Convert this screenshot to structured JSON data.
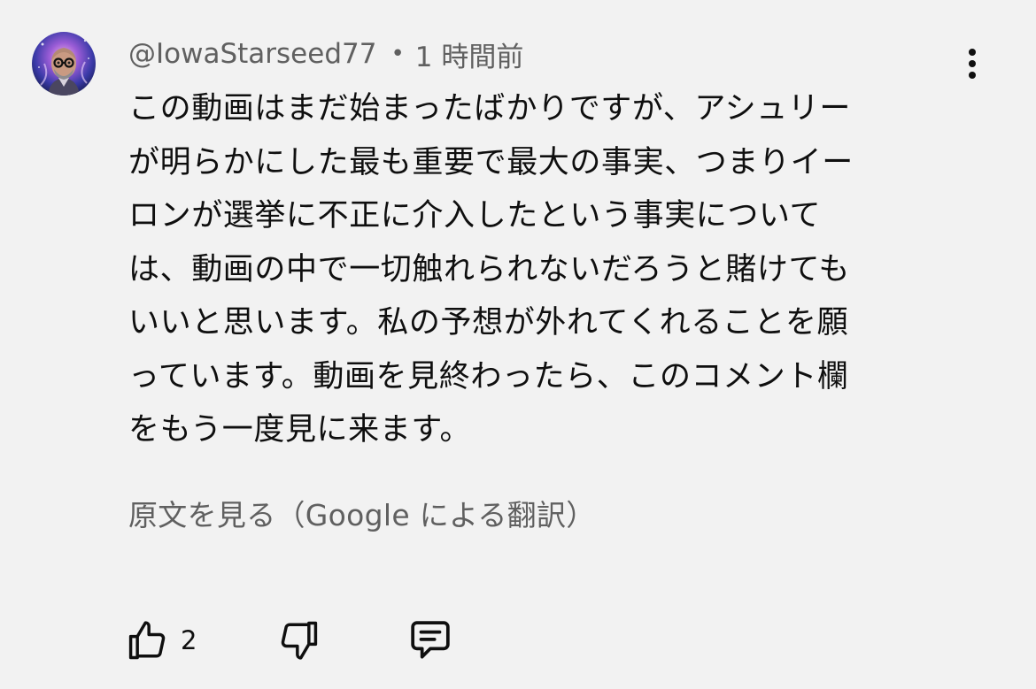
{
  "comment": {
    "author": "@IowaStarseed77",
    "separator": "•",
    "timestamp": "1 時間前",
    "text_lines": [
      "この動画はまだ始まったばかりですが、アシュリー",
      "が明らかにした最も重要で最大の事実、つまりイー",
      "ロンが選挙に不正に介入したという事実について",
      "は、動画の中で一切触れられないだろうと賭けても",
      "いいと思います。私の予想が外れてくれることを願",
      "っています。動画を見終わったら、このコメント欄",
      "をもう一度見に来ます。"
    ],
    "translation_link": "原文を見る（Google による翻訳）",
    "like_count": "2"
  },
  "icons": {
    "avatar": "user-avatar-cosmic-portrait",
    "more": "more-vertical-icon",
    "like": "thumbs-up-icon",
    "dislike": "thumbs-down-icon",
    "reply": "reply-comment-icon"
  },
  "colors": {
    "background": "#f2f2f2",
    "primary_text": "#0f0f0f",
    "secondary_text": "#606060"
  }
}
